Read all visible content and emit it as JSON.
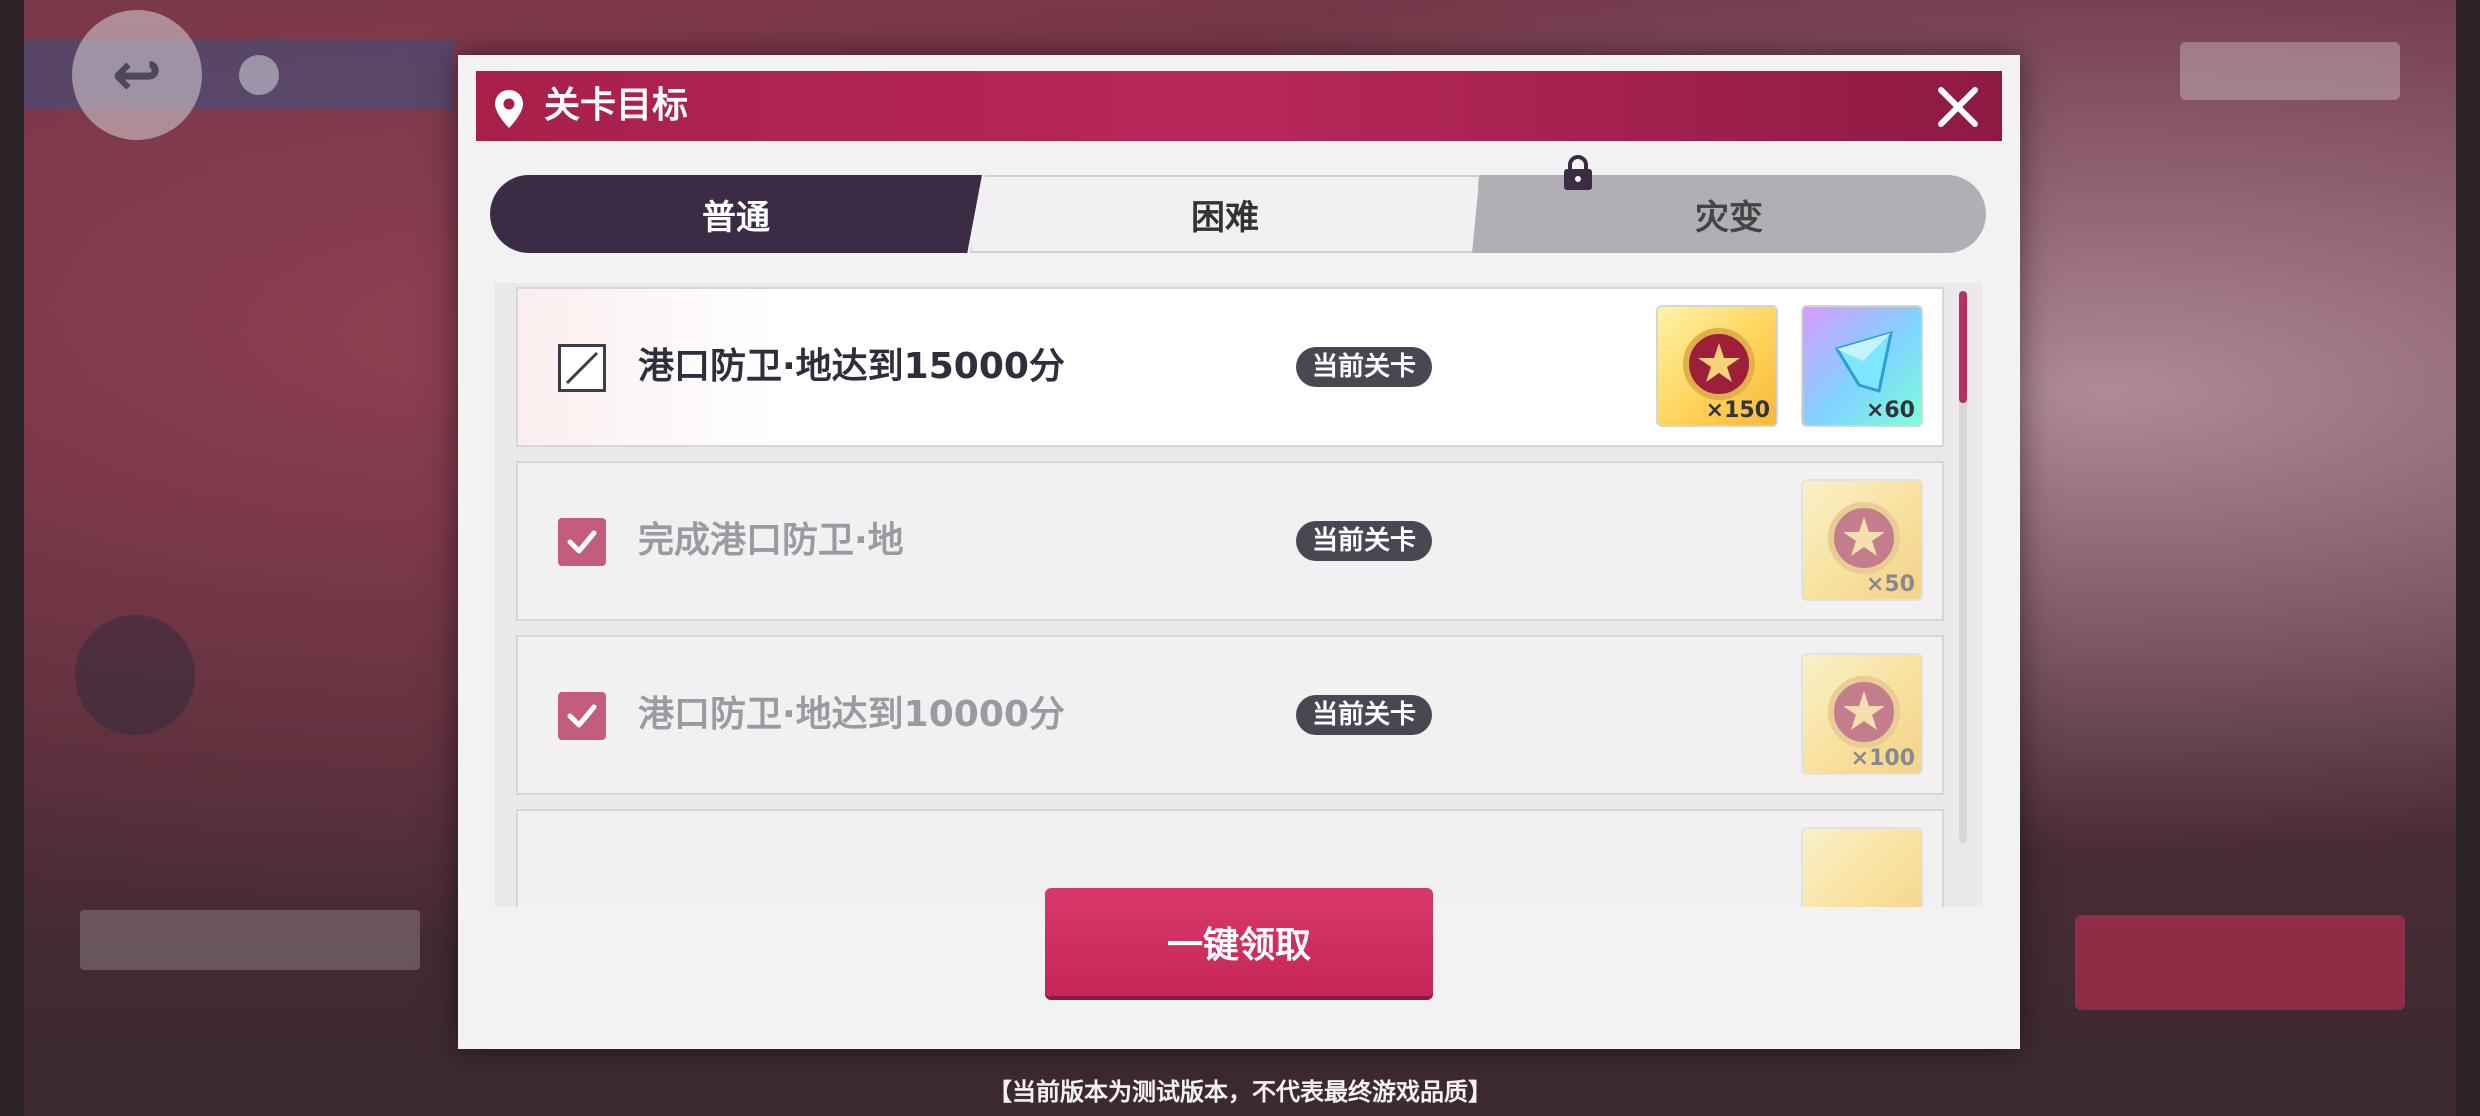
{
  "dialog": {
    "title": "关卡目标",
    "tabs": [
      {
        "label": "普通",
        "state": "selected"
      },
      {
        "label": "困难",
        "state": "available"
      },
      {
        "label": "灾变",
        "state": "locked"
      }
    ],
    "claim_all_label": "一键领取"
  },
  "objectives": [
    {
      "text": "港口防卫·地达到15000分",
      "tag": "当前关卡",
      "completed": false,
      "rewards": [
        {
          "icon": "badge-coin-icon",
          "qty": "×150"
        },
        {
          "icon": "crystal-icon",
          "qty": "×60"
        }
      ]
    },
    {
      "text": "完成港口防卫·地",
      "tag": "当前关卡",
      "completed": true,
      "rewards": [
        {
          "icon": "badge-coin-icon",
          "qty": "×50"
        }
      ]
    },
    {
      "text": "港口防卫·地达到10000分",
      "tag": "当前关卡",
      "completed": true,
      "rewards": [
        {
          "icon": "badge-coin-icon",
          "qty": "×100"
        }
      ]
    }
  ],
  "footer_note": "【当前版本为测试版本，不代表最终游戏品质】",
  "colors": {
    "header": "#a8204a",
    "selected_tab": "#3c2b44",
    "checkbox_done": "#c45d7c",
    "claim_button": "#d8396a"
  }
}
